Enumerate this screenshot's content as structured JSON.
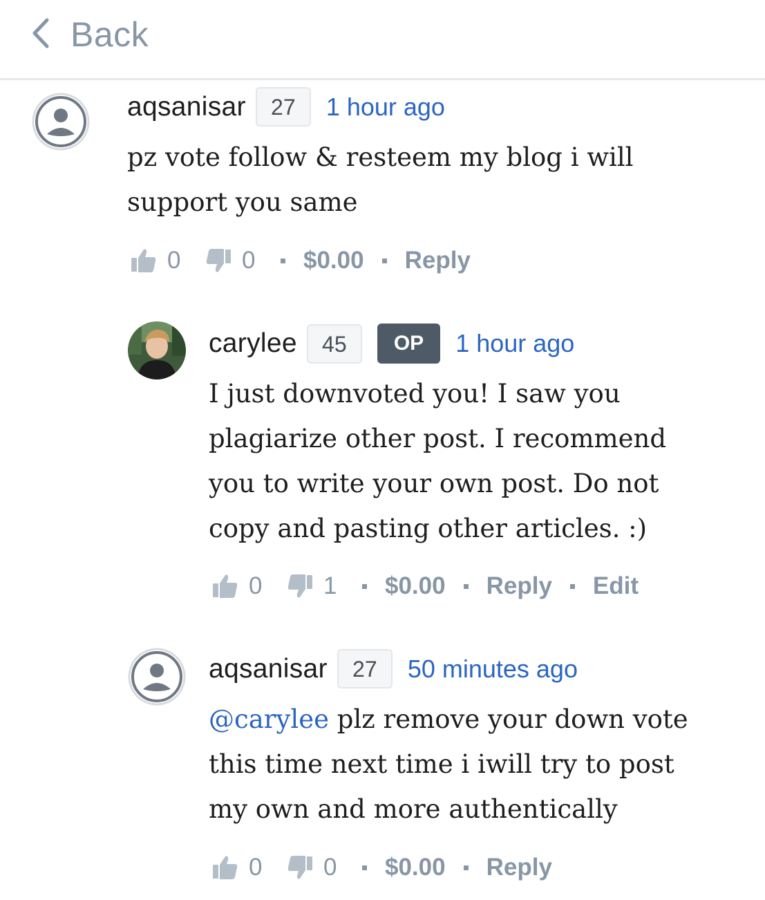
{
  "header": {
    "back_label": "Back",
    "back_icon": "chevron-left-icon"
  },
  "colors": {
    "link": "#2b65c2",
    "muted": "#8896a5",
    "op_badge": "#4e5a66"
  },
  "comments": [
    {
      "author": "aqsanisar",
      "reputation": "27",
      "time": "1 hour ago",
      "mention": "",
      "body": "pz vote follow & resteem my blog i will support you same",
      "upvotes": "0",
      "downvotes": "0",
      "payout": "$0.00",
      "reply_label": "Reply"
    },
    {
      "author": "carylee",
      "reputation": "45",
      "badge": "OP",
      "time": "1 hour ago",
      "mention": "",
      "body": "I just downvoted you! I saw you plagiarize other post. I recommend you to write your own post. Do not copy and pasting other articles. :)",
      "upvotes": "0",
      "downvotes": "1",
      "payout": "$0.00",
      "reply_label": "Reply",
      "edit_label": "Edit"
    },
    {
      "author": "aqsanisar",
      "reputation": "27",
      "time": "50 minutes ago",
      "mention": "@carylee",
      "body": " plz remove your down vote this time next time i iwill try to post my own and more authentically",
      "upvotes": "0",
      "downvotes": "0",
      "payout": "$0.00",
      "reply_label": "Reply"
    }
  ]
}
